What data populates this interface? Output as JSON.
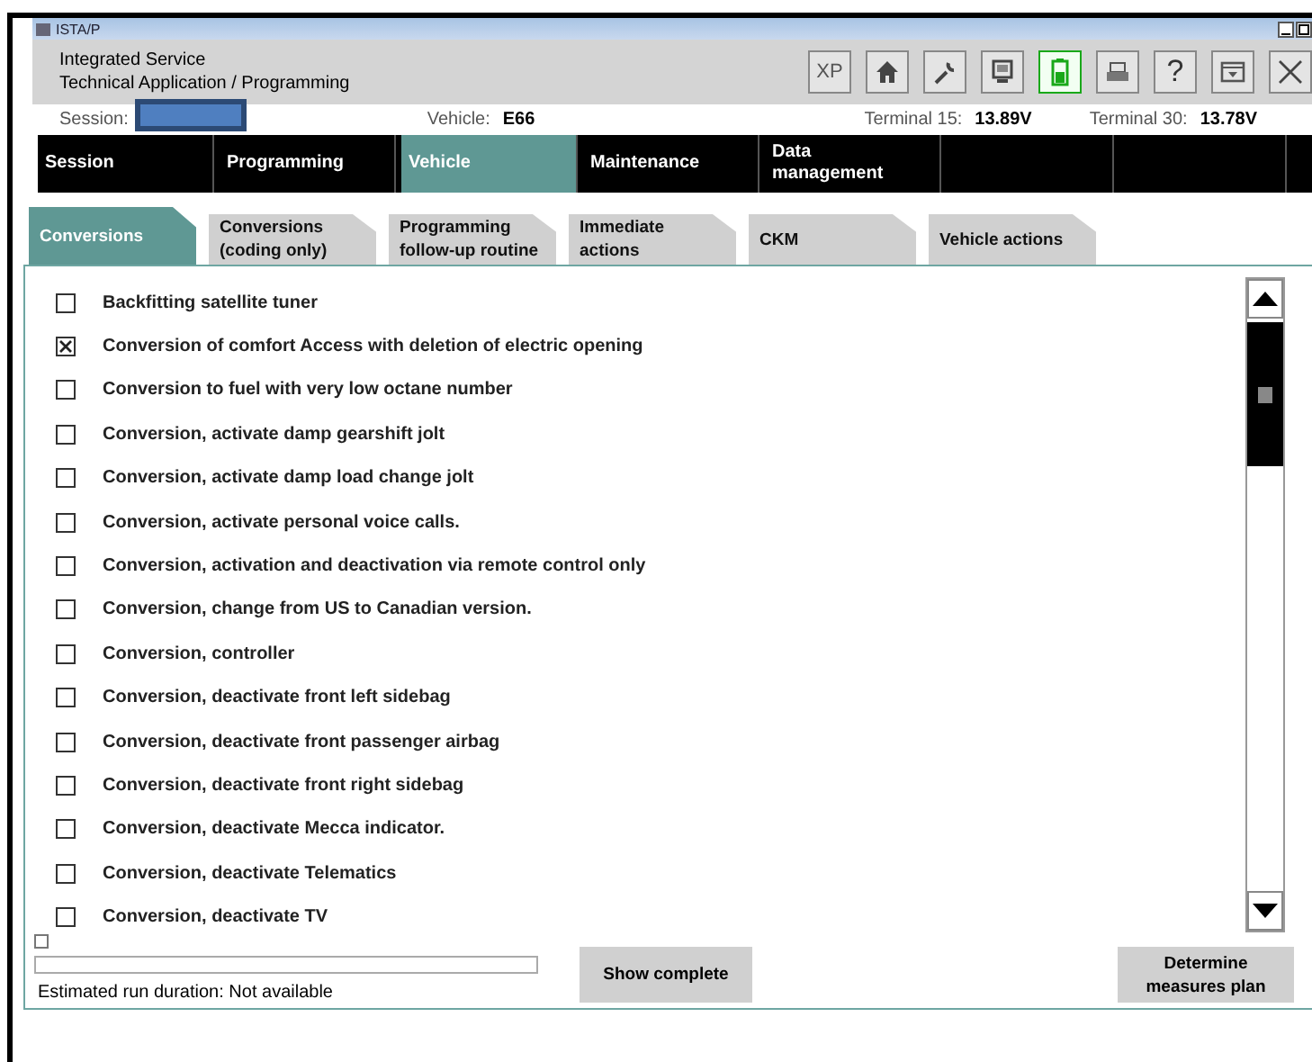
{
  "window": {
    "title": "ISTA/P"
  },
  "header": {
    "line_1": "Integrated Service",
    "line_2": "Technical Application / Programming",
    "toolbar": [
      {
        "kind": "text",
        "label": "XP"
      },
      {
        "kind": "home"
      },
      {
        "kind": "wrench"
      },
      {
        "kind": "device"
      },
      {
        "kind": "battery"
      },
      {
        "kind": "printer"
      },
      {
        "kind": "text",
        "label": "?"
      },
      {
        "kind": "panel"
      },
      {
        "kind": "close"
      }
    ]
  },
  "info": {
    "session_label": "Session:",
    "vehicle_label": "Vehicle:",
    "vehicle": "E66",
    "terminal_15_label": "Terminal 15:",
    "terminal_15": "13.89V",
    "terminal_30_label": "Terminal 30:",
    "terminal_30": "13.78V"
  },
  "nav": [
    {
      "label": "Session",
      "selected": false
    },
    {
      "label": "Programming",
      "selected": false
    },
    {
      "label": "Vehicle",
      "selected": true
    },
    {
      "label": "Maintenance",
      "selected": false
    },
    {
      "label": "Data\nmanagement",
      "selected": false
    }
  ],
  "tabs": [
    {
      "label": "Conversions",
      "selected": true
    },
    {
      "label": "Conversions\n(coding only)",
      "selected": false
    },
    {
      "label": "Programming\nfollow-up routine",
      "selected": false
    },
    {
      "label": "Immediate\nactions",
      "selected": false
    },
    {
      "label": "CKM",
      "selected": false
    },
    {
      "label": "Vehicle actions",
      "selected": false
    }
  ],
  "items": [
    {
      "label": "Backfitting satellite tuner",
      "checked": false
    },
    {
      "label": "Conversion of comfort Access with deletion of electric opening",
      "checked": true
    },
    {
      "label": "Conversion to fuel with very low octane number",
      "checked": false
    },
    {
      "label": "Conversion, activate damp gearshift jolt",
      "checked": false
    },
    {
      "label": "Conversion, activate damp load change jolt",
      "checked": false
    },
    {
      "label": "Conversion, activate personal voice calls.",
      "checked": false
    },
    {
      "label": "Conversion, activation and deactivation via remote control only",
      "checked": false
    },
    {
      "label": "Conversion, change from US to Canadian version.",
      "checked": false
    },
    {
      "label": "Conversion, controller",
      "checked": false
    },
    {
      "label": "Conversion, deactivate front left sidebag",
      "checked": false
    },
    {
      "label": "Conversion, deactivate front passenger airbag",
      "checked": false
    },
    {
      "label": "Conversion, deactivate front right sidebag",
      "checked": false
    },
    {
      "label": "Conversion, deactivate Mecca indicator.",
      "checked": false
    },
    {
      "label": "Conversion, deactivate Telematics",
      "checked": false
    },
    {
      "label": "Conversion, deactivate TV",
      "checked": false
    }
  ],
  "footer": {
    "estimate": "Estimated run duration: Not available",
    "buttons": [
      "Show complete",
      "Determine\nmeasures plan"
    ]
  }
}
